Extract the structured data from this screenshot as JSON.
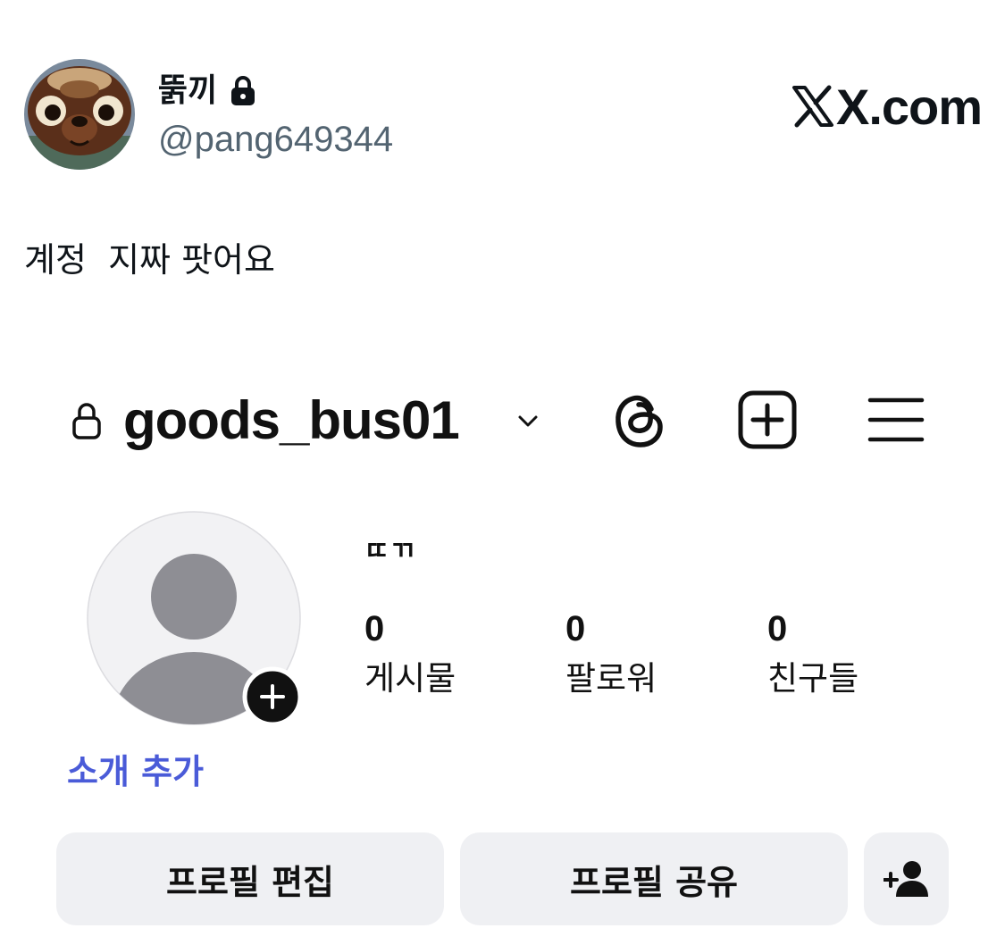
{
  "tweet": {
    "display_name": "뚥끼",
    "handle": "@pang649344",
    "brand": "X.com",
    "text": "계정  지짜 팟어요",
    "icons": {
      "avatar": "animal-character-avatar",
      "lock": "lock-icon",
      "logo": "x-logo-icon"
    },
    "colors": {
      "text": "#0f1419",
      "secondary": "#536471"
    }
  },
  "instagram": {
    "username": "goods_bus01",
    "full_name": "ㄸㄲ",
    "stats": [
      {
        "value": "0",
        "label": "게시물"
      },
      {
        "value": "0",
        "label": "팔로워"
      },
      {
        "value": "0",
        "label": "친구들"
      }
    ],
    "add_bio": "소개 추가",
    "buttons": {
      "edit_profile": "프로필 편집",
      "share_profile": "프로필 공유"
    },
    "icons": {
      "lock": "lock-icon",
      "switch": "chevron-down-icon",
      "threads": "threads-icon",
      "create": "plus-square-icon",
      "menu": "hamburger-menu-icon",
      "avatar": "default-avatar-icon",
      "add_story": "plus-circle-icon",
      "add_user": "add-user-icon"
    },
    "colors": {
      "link": "#4a5bd8",
      "button_bg": "#eff0f3",
      "avatar_fill": "#8e8e94",
      "avatar_bg": "#f2f2f4"
    }
  }
}
